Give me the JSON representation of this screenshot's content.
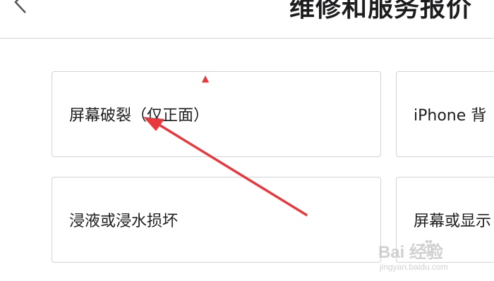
{
  "header": {
    "title": "维修和服务报价",
    "back_icon": "chevron-left-icon"
  },
  "options": [
    {
      "label": "屏幕破裂（仅正面）"
    },
    {
      "label": "iPhone 背"
    },
    {
      "label": "浸液或浸水损坏"
    },
    {
      "label": "屏幕或显示"
    }
  ],
  "annotation": {
    "color": "#e8383d",
    "icons": [
      "arrow-icon",
      "triangle-marker-icon"
    ]
  },
  "watermark": {
    "brand": "Bai 经验",
    "url": "jingyan.baidu.com"
  }
}
